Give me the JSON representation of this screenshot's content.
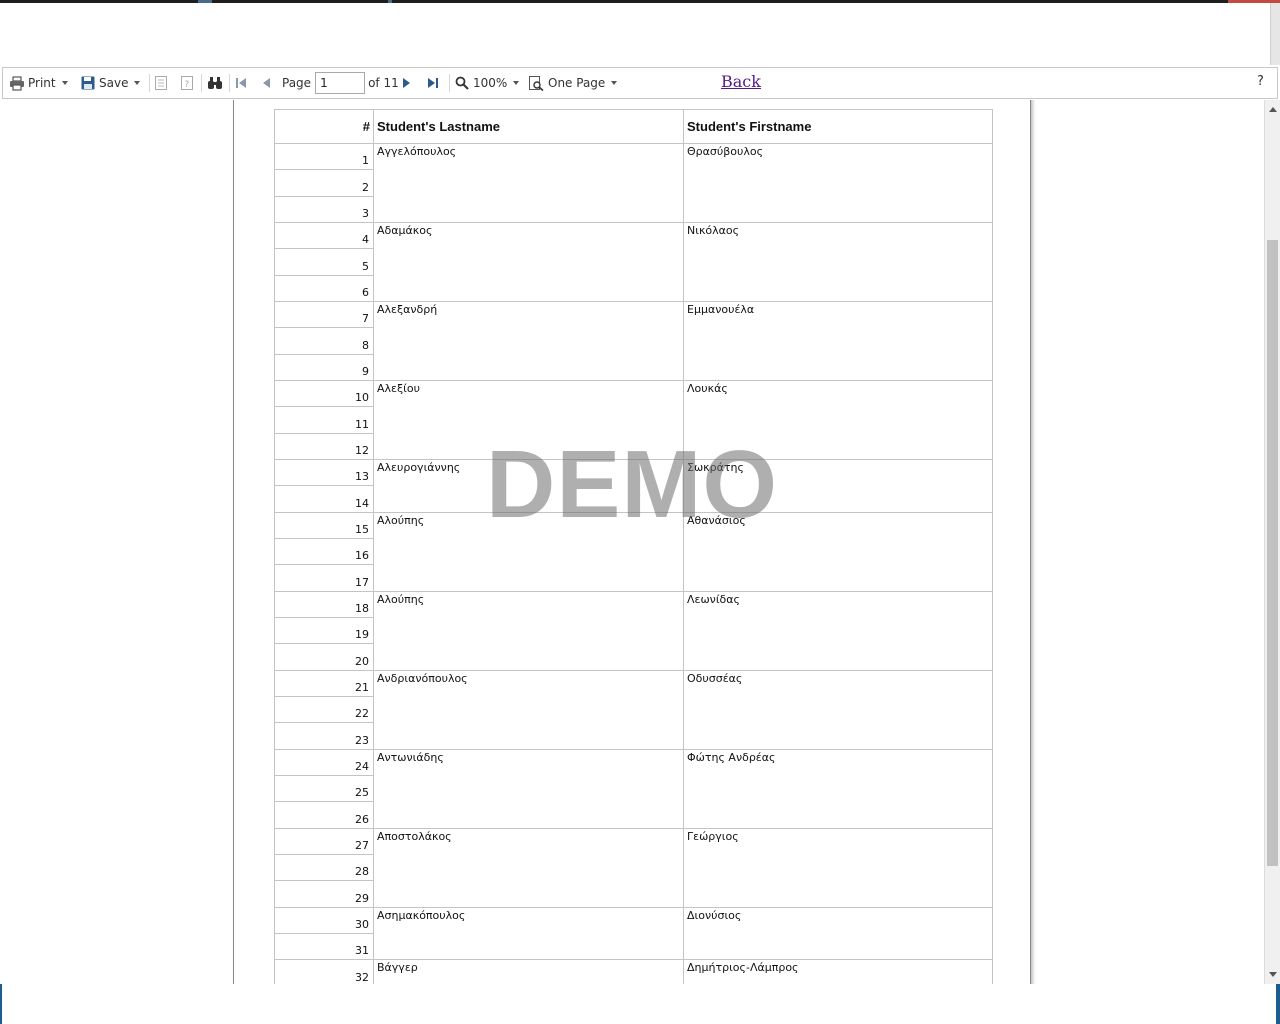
{
  "toolbar": {
    "print_label": "Print",
    "save_label": "Save",
    "page_label": "Page",
    "page_value": "1",
    "page_total": "of 11",
    "zoom_label": "100%",
    "view_mode_label": "One Page",
    "back_label": "Back",
    "help_label": "?"
  },
  "report": {
    "watermark": "DEMO",
    "headers": {
      "num": "#",
      "lastname": "Student's Lastname",
      "firstname": "Student's Firstname"
    },
    "groups": [
      {
        "rows": [
          "1",
          "2",
          "3"
        ],
        "lastname": "Αγγελόπουλος",
        "firstname": "Θρασύβουλος"
      },
      {
        "rows": [
          "4",
          "5",
          "6"
        ],
        "lastname": "Αδαμάκος",
        "firstname": "Νικόλαος"
      },
      {
        "rows": [
          "7",
          "8",
          "9"
        ],
        "lastname": "Αλεξανδρή",
        "firstname": "Εμμανουέλα"
      },
      {
        "rows": [
          "10",
          "11",
          "12"
        ],
        "lastname": "Αλεξίου",
        "firstname": "Λουκάς"
      },
      {
        "rows": [
          "13",
          "14"
        ],
        "lastname": "Αλευρογιάννης",
        "firstname": "Σωκράτης"
      },
      {
        "rows": [
          "15",
          "16",
          "17"
        ],
        "lastname": "Αλούπης",
        "firstname": "Αθανάσιος"
      },
      {
        "rows": [
          "18",
          "19",
          "20"
        ],
        "lastname": "Αλούπης",
        "firstname": "Λεωνίδας"
      },
      {
        "rows": [
          "21",
          "22",
          "23"
        ],
        "lastname": "Ανδριανόπουλος",
        "firstname": "Οδυσσέας"
      },
      {
        "rows": [
          "24",
          "25",
          "26"
        ],
        "lastname": "Αντωνιάδης",
        "firstname": "Φώτης Ανδρέας"
      },
      {
        "rows": [
          "27",
          "28",
          "29"
        ],
        "lastname": "Αποστολάκος",
        "firstname": "Γεώργιος"
      },
      {
        "rows": [
          "30",
          "31"
        ],
        "lastname": "Ασημακόπουλος",
        "firstname": "Διονύσιος"
      },
      {
        "rows": [
          "32"
        ],
        "lastname": "Βάγγερ",
        "firstname": "Δημήτριος-Λάμπρος"
      }
    ]
  },
  "colors": {
    "link": "#551a8b",
    "nav_active": "#2c5a8a",
    "nav_disabled": "#8a9aac",
    "watermark": "#6e6e6e"
  }
}
